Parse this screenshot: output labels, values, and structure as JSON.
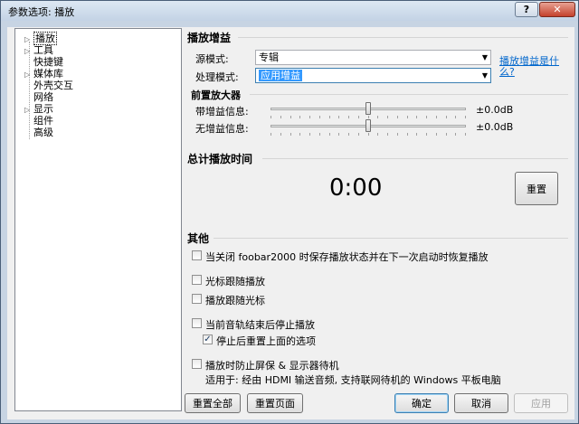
{
  "window": {
    "title": "参数选项: 播放",
    "help_label": "?",
    "close_label": "✕"
  },
  "tree": {
    "items": [
      {
        "label": "播放",
        "expandable": true,
        "selected": true
      },
      {
        "label": "工具",
        "expandable": true,
        "selected": false
      },
      {
        "label": "快捷键",
        "expandable": false,
        "selected": false
      },
      {
        "label": "媒体库",
        "expandable": true,
        "selected": false
      },
      {
        "label": "外壳交互",
        "expandable": false,
        "selected": false
      },
      {
        "label": "网络",
        "expandable": false,
        "selected": false
      },
      {
        "label": "显示",
        "expandable": true,
        "selected": false
      },
      {
        "label": "组件",
        "expandable": false,
        "selected": false
      },
      {
        "label": "高级",
        "expandable": false,
        "selected": false
      }
    ]
  },
  "replaygain": {
    "title": "播放增益",
    "source_mode_label": "源模式:",
    "source_mode_value": "专辑",
    "processing_mode_label": "处理模式:",
    "processing_mode_value": "应用增益",
    "help_link": "播放增益是什么?"
  },
  "preamp": {
    "title": "前置放大器",
    "with_info_label": "带增益信息:",
    "with_info_value": "±0.0dB",
    "with_info_level": 0.5,
    "without_info_label": "无增益信息:",
    "without_info_value": "±0.0dB",
    "without_info_level": 0.5
  },
  "total_time": {
    "title": "总计播放时间",
    "value": "0:00",
    "reset_label": "重置"
  },
  "other": {
    "title": "其他",
    "options": [
      {
        "label": "当关闭 foobar2000 时保存播放状态并在下一次启动时恢复播放",
        "checked": false
      },
      {
        "label": "光标跟随播放",
        "checked": false
      },
      {
        "label": "播放跟随光标",
        "checked": false
      },
      {
        "label": "当前音轨结束后停止播放",
        "checked": false
      },
      {
        "label": "停止后重置上面的选项",
        "checked": true
      },
      {
        "label": "播放时防止屏保 & 显示器待机",
        "checked": false
      }
    ],
    "note": "适用于: 经由 HDMI 输送音频, 支持联网待机的 Windows 平板电脑"
  },
  "footer": {
    "reset_all_label": "重置全部",
    "reset_page_label": "重置页面",
    "ok_label": "确定",
    "cancel_label": "取消",
    "apply_label": "应用"
  }
}
